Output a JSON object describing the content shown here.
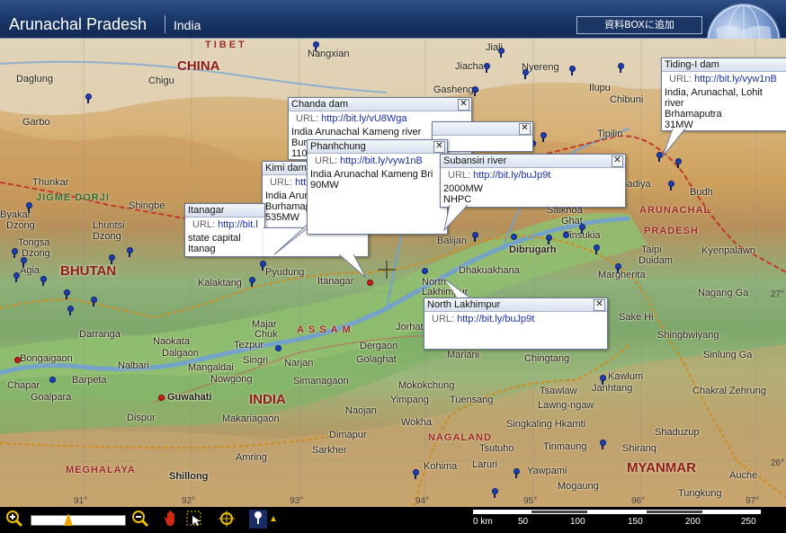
{
  "header": {
    "title": "Arunachal Pradesh",
    "subtitle": "India",
    "add_button": "資料BOXに追加"
  },
  "map": {
    "countries": [
      {
        "name": "CHINA"
      },
      {
        "name": "BHUTAN"
      },
      {
        "name": "INDIA"
      },
      {
        "name": "MYANMAR"
      }
    ],
    "regions": [
      "TIBET",
      "JIGME DORJI",
      "ARUNACHAL",
      "PRADESH",
      "ASSAM",
      "NAGALAND",
      "MEGHALAYA"
    ],
    "places": [
      "Nangxian",
      "Jiali",
      "Daglung",
      "Chigu",
      "Garbo",
      "Jiacha",
      "Gashengo",
      "Nyereng",
      "Ilupu",
      "Chibuni",
      "Tipilin",
      "Thunkar",
      "Shingbe",
      "Byakar",
      "Dzong",
      "Lhuntsi",
      "Dzong",
      "Tongsa",
      "Dzong",
      "Agia",
      "Budh",
      "Sadiya",
      "Saikhoa",
      "Ghat",
      "Tinsukia",
      "Dibrugarh",
      "Balijan",
      "Dhakuakhana",
      "North",
      "Lakhimpur",
      "Taipi",
      "Duidam",
      "Kyenpalawn",
      "Margherita",
      "Nagang Ga",
      "Pyudung",
      "Itanagar",
      "Kalaktang",
      "Darranga",
      "Majar",
      "Chuk",
      "Naokata",
      "Dalgaon",
      "Tezpur",
      "Bongaigaon",
      "Nalbari",
      "Mangaldai",
      "Singri",
      "Barpeta",
      "Nowgong",
      "Chapar",
      "Goalpara",
      "Guwahati",
      "Dispur",
      "Makariagaon",
      "Shillong",
      "Narjan",
      "Dergaon",
      "Golaghat",
      "Simanagaon",
      "Jorhat",
      "Mariani",
      "Chingtang",
      "Sake Hi",
      "Shingbwiyang",
      "Kawlum",
      "Janhtang",
      "Tsawlaw",
      "Lawng-ngaw",
      "Singkaling Hkamti",
      "Tinmaung",
      "Shiranq",
      "Shaduzup",
      "Auche",
      "Tungkung",
      "Sinlung Ga",
      "Chakral Zehrung",
      "Naojan",
      "Mokokchung",
      "Yimpang",
      "Tuensang",
      "Wokha",
      "Dimapur",
      "Sarkher",
      "Amring",
      "Kohima",
      "Laruri",
      "Tsutuho",
      "Yawpami",
      "Mogaung"
    ],
    "coords": [
      "27°",
      "26°",
      "92°",
      "93°",
      "94°",
      "95°",
      "96°",
      "97°",
      "91°"
    ]
  },
  "popups": [
    {
      "title": "Tiding-I dam",
      "url_label": "URL:",
      "url": "http://bit.ly/vyw1nB",
      "body": "India, Arunachal, Lohit river\nBrhamaputra\n31MW"
    },
    {
      "title": "Chanda dam",
      "url_label": "URL:",
      "url": "http://bit.ly/vU8Wga",
      "body": "India Arunachal  Kameng river\nBur\n110"
    },
    {
      "title": "",
      "url_label": "URL:",
      "url": "",
      "body": ""
    },
    {
      "title": "Phanhchung",
      "url_label": "URL:",
      "url": "http://bit.ly/vyw1nB",
      "body": "India  Arunachal Kameng  Bri\n90MW"
    },
    {
      "title": "Subansiri river",
      "url_label": "URL:",
      "url": "http://bit.ly/buJp9t",
      "body": "2000MW\nNHPC"
    },
    {
      "title": "Kimi dam",
      "url_label": "URL:",
      "url": "htt",
      "body": "India Arun\nBurhamaputr\n535MW"
    },
    {
      "title": "Itanagar",
      "url_label": "URL:",
      "url": "http://bit.l",
      "body": "state capital Itanag"
    },
    {
      "title": "North Lakhimpur",
      "url_label": "URL:",
      "url": "http://bit.ly/buJp9t",
      "body": ""
    }
  ],
  "toolbar": {
    "zoom_in": "zoom-in-icon",
    "zoom_out": "zoom-out-icon",
    "zoom_level": 0.36
  },
  "scale": {
    "ticks": [
      "0 km",
      "50",
      "100",
      "150",
      "200",
      "250"
    ]
  },
  "colors": {
    "header": "#183566",
    "river": "#6f9fd8",
    "border_state": "#d08a1e",
    "border_country": "#c0392b"
  }
}
